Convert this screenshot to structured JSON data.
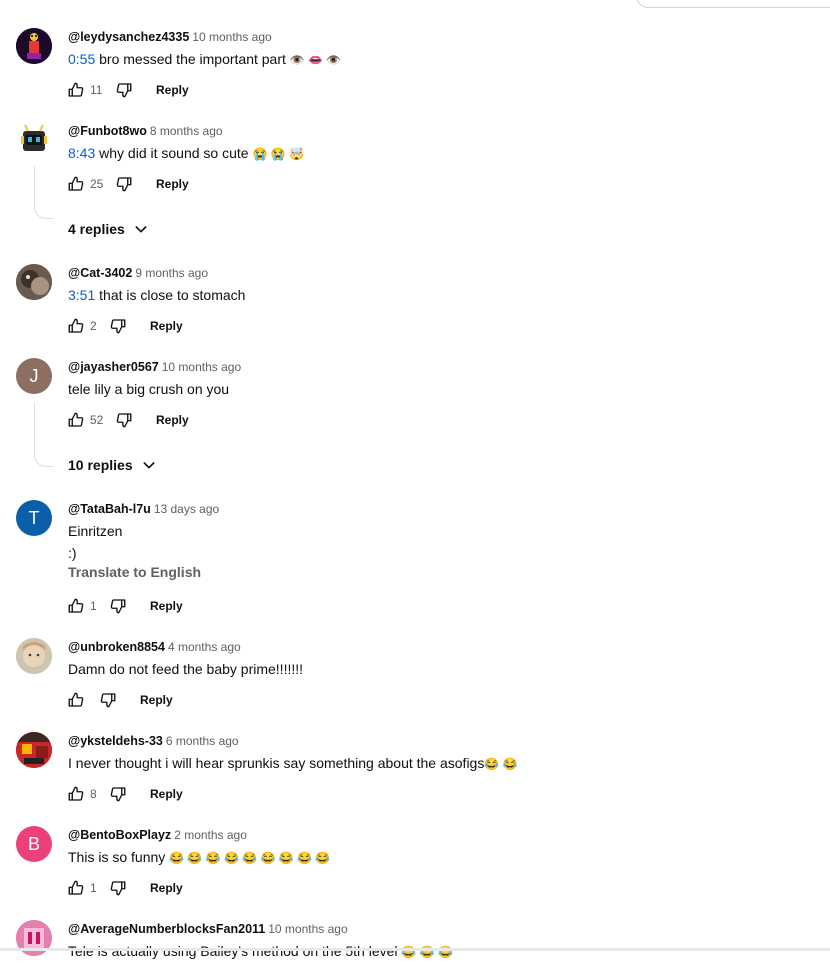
{
  "reply_label": "Reply",
  "translate_label": "Translate to English",
  "colors": {
    "timestamp_link": "#065fd4",
    "meta_gray": "#606060"
  },
  "comments": [
    {
      "author": "@leydysanchez4335",
      "time": "10 months ago",
      "timestamp": "0:55",
      "text": "bro messed the important part",
      "emoji": "👁️ 👄 👁️",
      "likes": "11",
      "avatar_type": "image-figure"
    },
    {
      "author": "@Funbot8wo",
      "time": "8 months ago",
      "timestamp": "8:43",
      "text": "why did it sound so cute",
      "emoji": "😭 😭 🤯",
      "likes": "25",
      "avatar_type": "image-robot",
      "replies": "4 replies"
    },
    {
      "author": "@Cat-3402",
      "time": "9 months ago",
      "timestamp": "3:51",
      "text": "that is close to stomach",
      "likes": "2",
      "avatar_type": "image-photo-dark"
    },
    {
      "author": "@jayasher0567",
      "time": "10 months ago",
      "text": "tele lily a big crush on you",
      "likes": "52",
      "avatar_letter": "J",
      "avatar_color": "#8d6e63",
      "replies": "10 replies"
    },
    {
      "author": "@TataBah-l7u",
      "time": "13 days ago",
      "text": "Einritzen",
      "text2": ":)",
      "likes": "1",
      "avatar_letter": "T",
      "avatar_color": "#0b5ea8"
    },
    {
      "author": "@unbroken8854",
      "time": "4 months ago",
      "text": "Damn do not feed the baby prime!!!!!!!",
      "likes": "",
      "avatar_type": "image-photo-light"
    },
    {
      "author": "@yksteldehs-33",
      "time": "6 months ago",
      "text": "I never thought i will hear sprunkis say something about the asofigs",
      "emoji": "😂 😂",
      "likes": "8",
      "avatar_type": "image-red"
    },
    {
      "author": "@BentoBoxPlayz",
      "time": "2 months ago",
      "text": "This is so funny",
      "emoji": "😂 😂 😂 😂 😂 😂 😂 😂 😂",
      "likes": "1",
      "avatar_letter": "B",
      "avatar_color": "#ec407a"
    },
    {
      "author": "@AverageNumberblocksFan2011",
      "time": "10 months ago",
      "text": "Tele is actually using Bailey's method on the 5th level",
      "emoji": "😂 😂 😂",
      "avatar_type": "image-pink"
    }
  ]
}
